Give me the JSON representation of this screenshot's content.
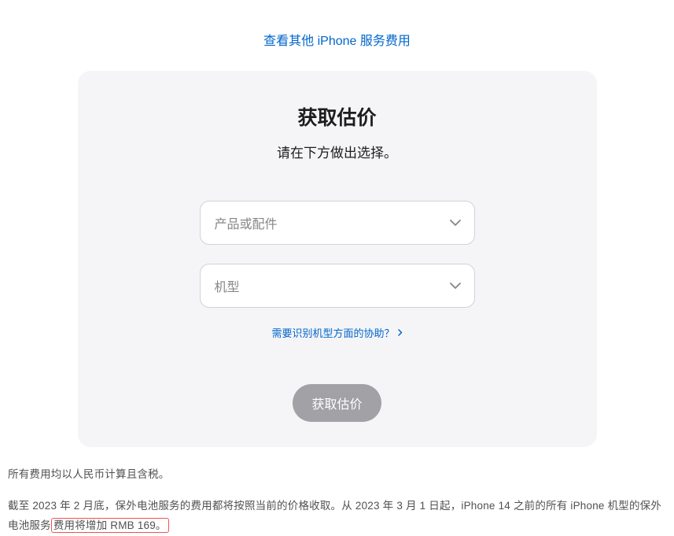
{
  "topLink": {
    "label": "查看其他 iPhone 服务费用"
  },
  "card": {
    "title": "获取估价",
    "subtitle": "请在下方做出选择。",
    "select1": {
      "placeholder": "产品或配件"
    },
    "select2": {
      "placeholder": "机型"
    },
    "helpLink": {
      "label": "需要识别机型方面的协助？"
    },
    "submit": {
      "label": "获取估价"
    }
  },
  "footnote1": "所有费用均以人民币计算且含税。",
  "footnote2": {
    "part1": "截至 2023 年 2 月底，保外电池服务的费用都将按照当前的价格收取。从 2023 年 3 月 1 日起，iPhone 14 之前的所有 iPhone 机型的保外电池服务",
    "highlighted": "费用将增加 RMB 169。"
  }
}
